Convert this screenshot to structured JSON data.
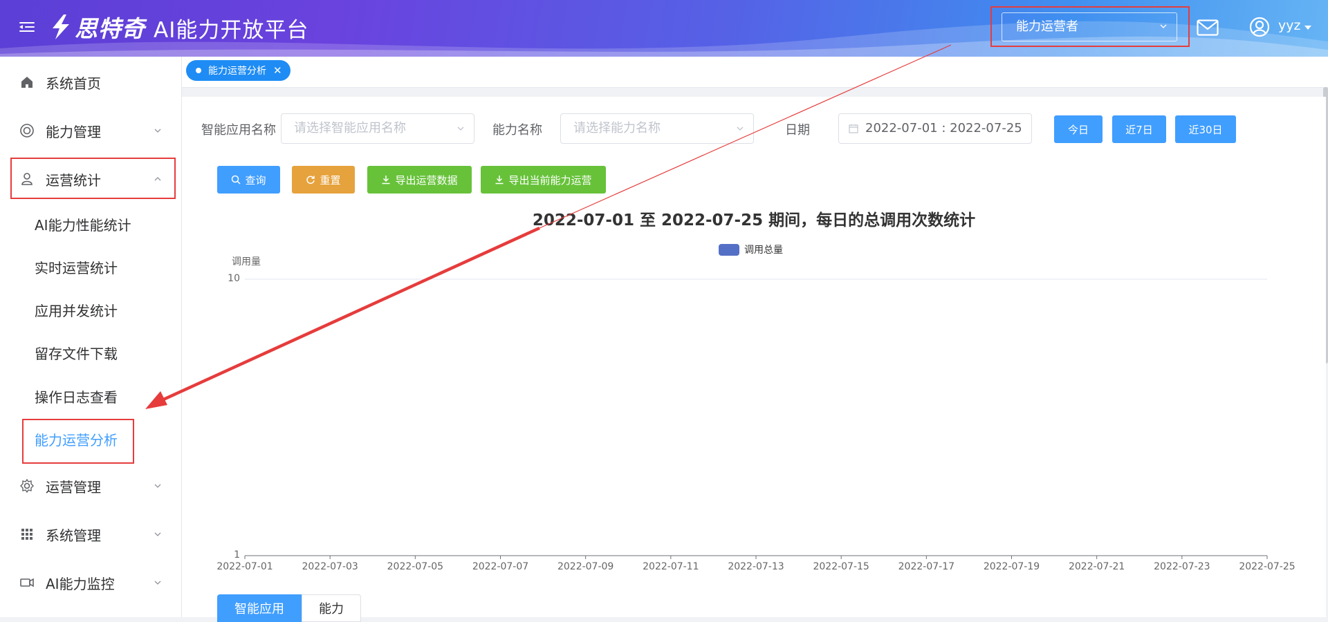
{
  "header": {
    "logo_text": "思特奇",
    "app_title": "AI能力开放平台",
    "role_select_value": "能力运营者",
    "user_name": "yyz",
    "icons": {
      "menu": "menu-fold-icon",
      "mail": "mail-icon",
      "user": "user-circle-icon"
    }
  },
  "sidebar": {
    "items": [
      {
        "label": "系统首页",
        "icon": "home-icon"
      },
      {
        "label": "能力管理",
        "icon": "capability-icon"
      },
      {
        "label": "运营统计",
        "icon": "stats-user-icon"
      },
      {
        "label": "运营管理",
        "icon": "gear-icon"
      },
      {
        "label": "系统管理",
        "icon": "grid-icon"
      },
      {
        "label": "AI能力监控",
        "icon": "camera-icon"
      }
    ],
    "submenu": [
      "AI能力性能统计",
      "实时运营统计",
      "应用并发统计",
      "留存文件下载",
      "操作日志查看",
      "能力运营分析"
    ]
  },
  "tabs": [
    {
      "label": "能力运营分析"
    }
  ],
  "filters": {
    "app_name_label": "智能应用名称",
    "app_name_placeholder": "请选择智能应用名称",
    "ability_label": "能力名称",
    "ability_placeholder": "请选择能力名称",
    "date_label": "日期",
    "date_value": "2022-07-01 : 2022-07-25",
    "quick_today": "今日",
    "quick_7": "近7日",
    "quick_30": "近30日"
  },
  "actions": {
    "query": "查询",
    "reset": "重置",
    "export_ops": "导出运营数据",
    "export_current": "导出当前能力运营"
  },
  "chart_data": {
    "type": "line",
    "title": "2022-07-01 至 2022-07-25 期间，每日的总调用次数统计",
    "ylabel": "调用量",
    "legend": [
      "调用总量"
    ],
    "ylim": [
      1,
      10
    ],
    "y_ticks": [
      "10",
      "1"
    ],
    "y_scale": "log",
    "x_ticks": [
      "2022-07-01",
      "2022-07-03",
      "2022-07-05",
      "2022-07-07",
      "2022-07-09",
      "2022-07-11",
      "2022-07-13",
      "2022-07-15",
      "2022-07-17",
      "2022-07-19",
      "2022-07-21",
      "2022-07-23",
      "2022-07-25"
    ],
    "series": [
      {
        "name": "调用总量",
        "values": []
      }
    ],
    "color": "#5470c6"
  },
  "bottom_tabs": [
    "智能应用",
    "能力"
  ],
  "colors": {
    "primary": "#409eff",
    "warning": "#e6a23c",
    "success": "#67c23a",
    "annotation": "#e63c3c"
  }
}
